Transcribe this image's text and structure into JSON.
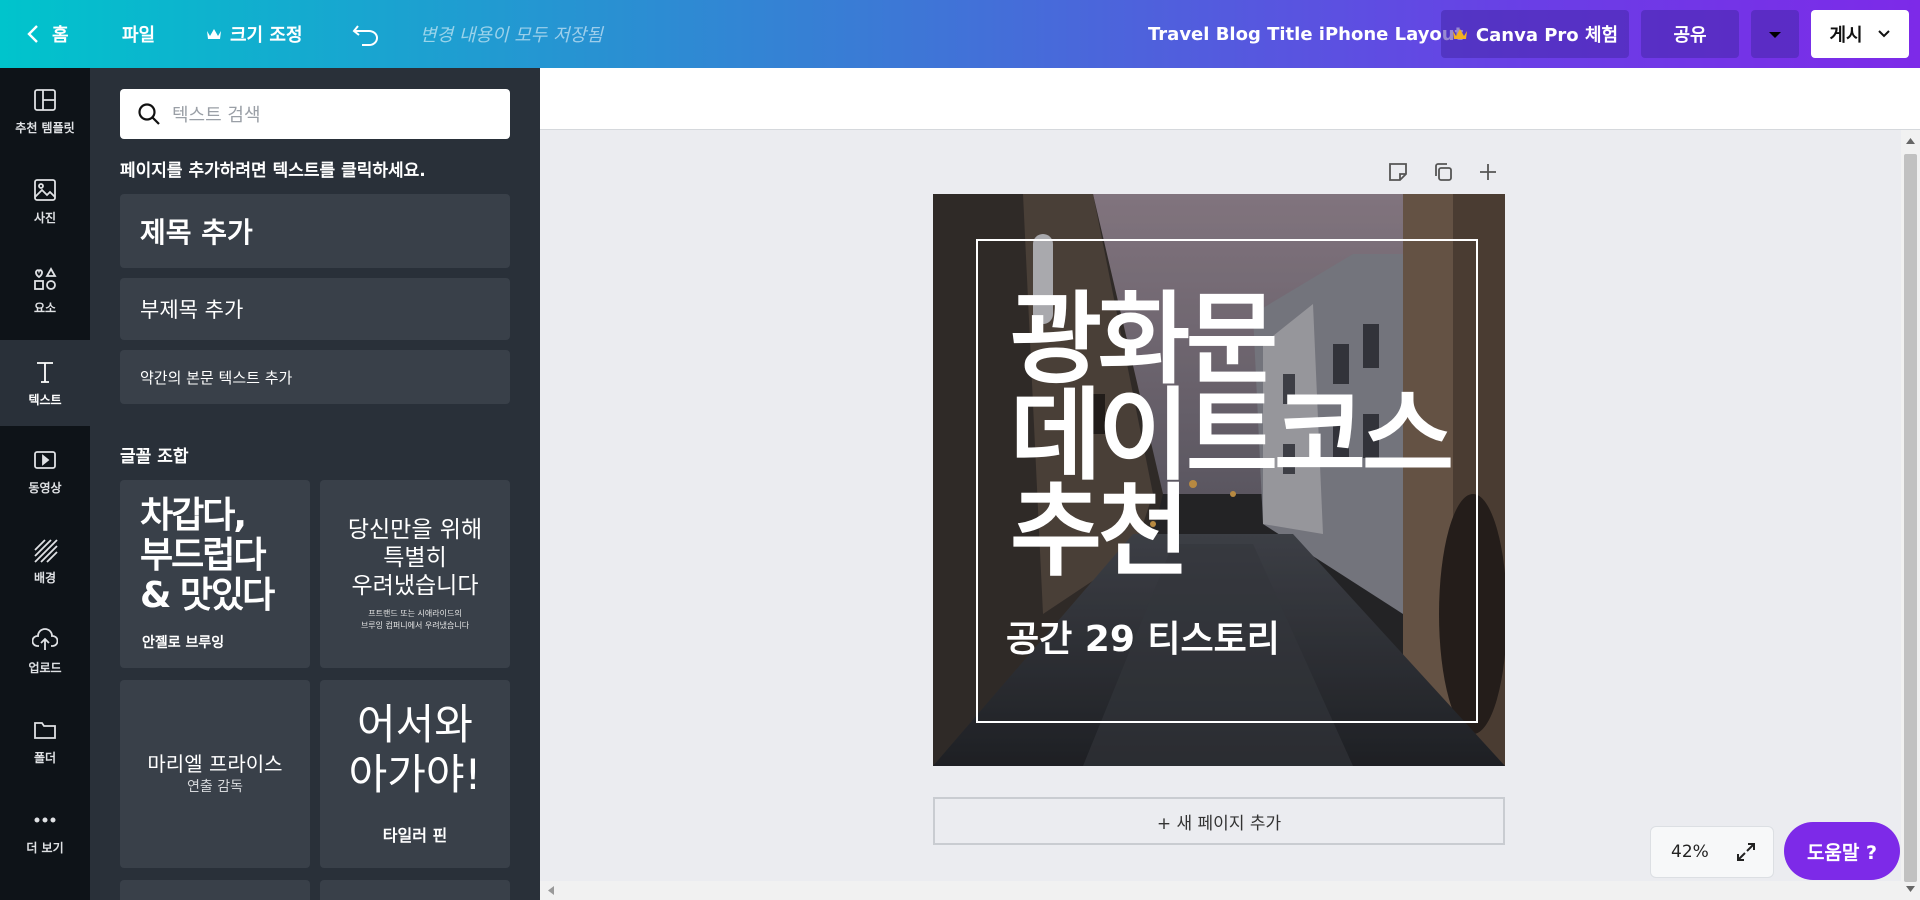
{
  "topbar": {
    "home_label": "홈",
    "file_label": "파일",
    "resize_label": "크기 조정",
    "saved_status": "변경 내용이 모두 저장됨",
    "doc_title": "Travel Blog Title iPhone Layout",
    "pro_label": "Canva Pro 체험",
    "share_label": "공유",
    "publish_label": "게시"
  },
  "rail": {
    "items": [
      {
        "label": "추천 템플릿",
        "icon": "template-icon"
      },
      {
        "label": "사진",
        "icon": "photo-icon"
      },
      {
        "label": "요소",
        "icon": "elements-icon"
      },
      {
        "label": "텍스트",
        "icon": "text-icon"
      },
      {
        "label": "동영상",
        "icon": "video-icon"
      },
      {
        "label": "배경",
        "icon": "background-icon"
      },
      {
        "label": "업로드",
        "icon": "upload-icon"
      },
      {
        "label": "폴더",
        "icon": "folder-icon"
      },
      {
        "label": "더 보기",
        "icon": "more-icon"
      }
    ]
  },
  "panel": {
    "search_placeholder": "텍스트 검색",
    "hint": "페이지를 추가하려면 텍스트를 클릭하세요.",
    "add_heading": "제목 추가",
    "add_subheading": "부제목 추가",
    "add_body": "약간의 본문 텍스트 추가",
    "combos_title": "글꼴 조합",
    "combos": [
      {
        "main": "차갑다,\n부드럽다\n& 맛있다",
        "caption": "안젤로 브루잉"
      },
      {
        "main": "당신만을 위해\n특별히\n우려냈습니다",
        "caption": "프트랜드 또는 시애라이드의\n브루잉 컴퍼니에서 우려냈습니다"
      },
      {
        "main": "마리엘 프라이스",
        "caption": "연출 감독"
      },
      {
        "main": "어서와\n아가야!",
        "caption": "타일러 핀"
      }
    ]
  },
  "design": {
    "headline_line1": "광화문",
    "headline_line2": "데이트코스",
    "headline_line3": "추천",
    "subline": "공간 29 티스토리"
  },
  "canvas": {
    "add_page_label": "+ 새 페이지 추가",
    "zoom_level": "42%",
    "help_label": "도움말 ?"
  },
  "colors": {
    "accent": "#7d2ae8",
    "panel": "#293039",
    "rail": "#0e1318"
  }
}
